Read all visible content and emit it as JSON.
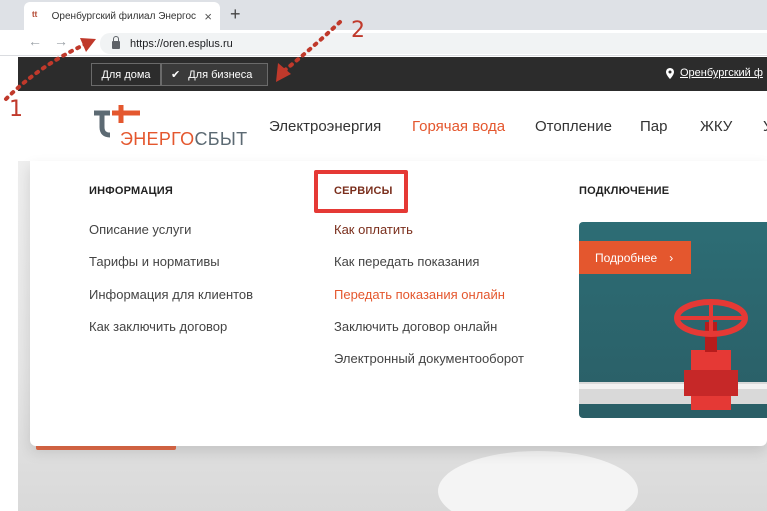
{
  "browser": {
    "tab_title": "Оренбургский филиал Энергос",
    "tab_favicon": "ᵗᵗ",
    "tab_close": "×",
    "new_tab": "+",
    "back": "←",
    "forward": "→",
    "url": "https://oren.esplus.ru"
  },
  "topbar": {
    "home_label": "Для дома",
    "business_label": "Для бизнеса",
    "check": "✔",
    "pin": "⬤",
    "region": "Оренбургский ф"
  },
  "logo": {
    "part1": "ЭНЕРГО",
    "part2": "СБЫТ"
  },
  "nav": [
    "Электроэнергия",
    "Горячая вода",
    "Отопление",
    "Пар",
    "ЖКУ",
    "У"
  ],
  "dropdown": {
    "info": {
      "heading": "ИНФОРМАЦИЯ",
      "links": [
        "Описание услуги",
        "Тарифы и нормативы",
        "Информация для клиентов",
        "Как заключить договор"
      ]
    },
    "services": {
      "heading": "СЕРВИСЫ",
      "links": [
        "Как оплатить",
        "Как передать показания",
        "Передать показания онлайн",
        "Заключить договор онлайн",
        "Электронный документооборот"
      ]
    },
    "connect": {
      "heading": "ПОДКЛЮЧЕНИЕ",
      "promo_label": "Подробнее",
      "promo_arrow": "›"
    }
  },
  "annotations": {
    "one": "1",
    "two": "2"
  },
  "colors": {
    "accent": "#e4572e",
    "annotation": "#c0392b",
    "dark_bar": "#2c2c2c",
    "promo_bg": "#2d6d75"
  }
}
